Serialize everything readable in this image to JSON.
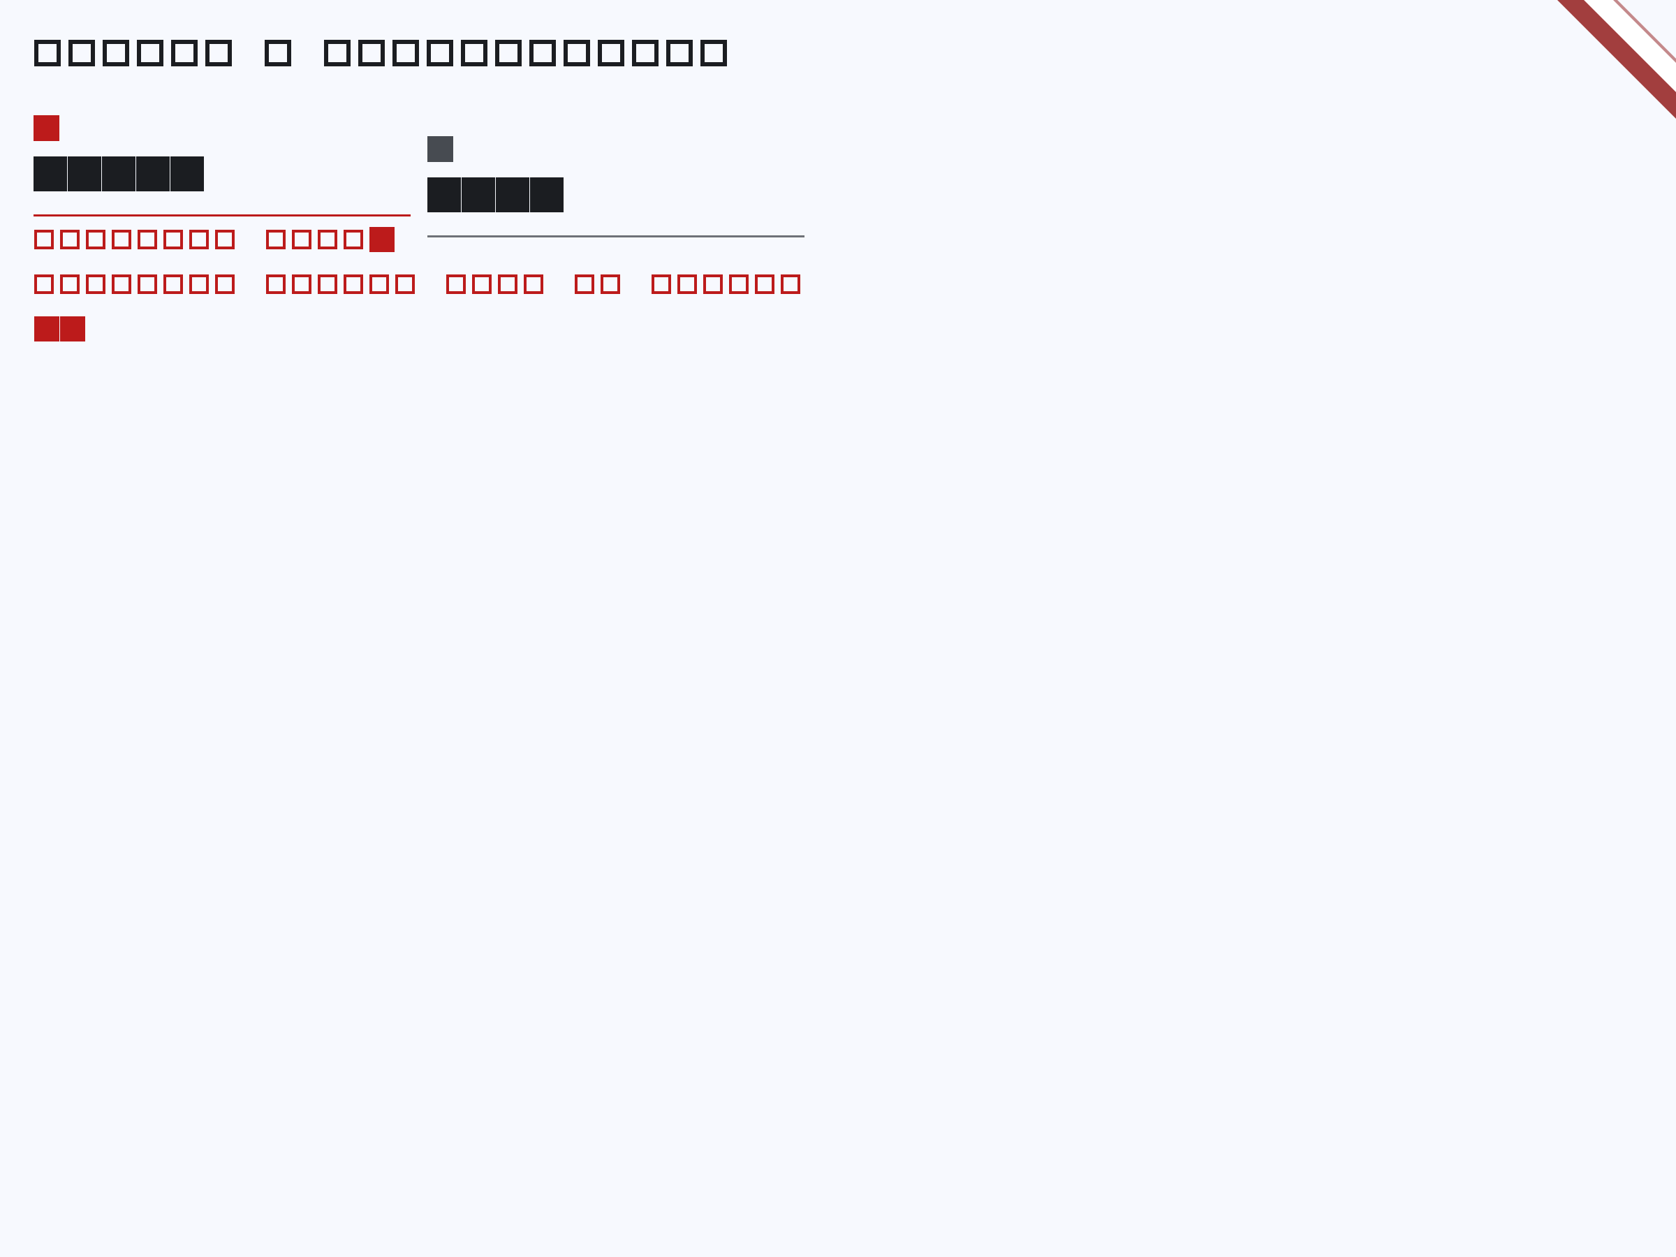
{
  "app": {
    "title": "□□□□□□ □ □□□□□□□□□□□□"
  },
  "tabs": [
    {
      "label": "□□□□□",
      "icon": "tab-icon-square",
      "active": true
    },
    {
      "label": "□□□□",
      "icon": "tab-icon-square",
      "active": false
    }
  ],
  "description": {
    "lines": [
      "□□□□□□□□ □□□□■",
      "□□□□□□□□ □□□□□□ □□□□ □□ □□□□□□",
      "■■"
    ]
  },
  "colors": {
    "background": "#f7f9fe",
    "accent": "#bc1b1b",
    "text": "#1b1d21",
    "muted": "#474b51",
    "ribbon": "#a23e3e"
  }
}
